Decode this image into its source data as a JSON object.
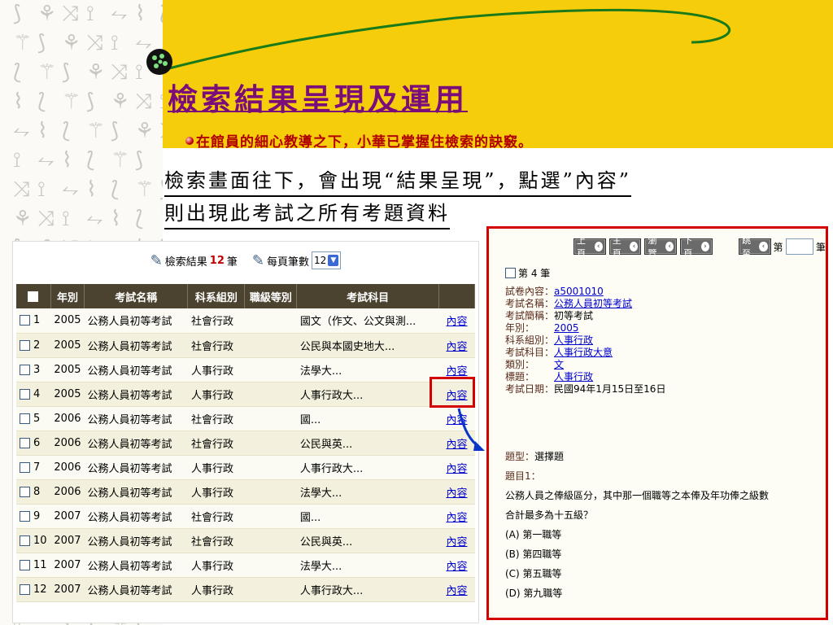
{
  "slide": {
    "title": "檢索結果呈現及運用",
    "subtitle": "在館員的細心教導之下，小華已掌握住檢索的訣竅。",
    "body_line1": "檢索畫面往下，會出現“結果呈現”，點選”內容”",
    "body_line2": "則出現此考試之所有考題資料"
  },
  "results": {
    "count_prefix": "檢索結果",
    "count": "12",
    "count_suffix": "筆",
    "per_page_label": "每頁筆數",
    "per_page_value": "12",
    "columns": [
      "年別",
      "考試名稱",
      "科系組別",
      "職級等別",
      "考試科目"
    ],
    "rows": [
      {
        "no": "1",
        "year": "2005",
        "exam": "公務人員初等考試",
        "dept": "社會行政",
        "grade": "",
        "subject": "國文（作文、公文與測...",
        "link": "內容"
      },
      {
        "no": "2",
        "year": "2005",
        "exam": "公務人員初等考試",
        "dept": "社會行政",
        "grade": "",
        "subject": "公民與本國史地大...",
        "link": "內容"
      },
      {
        "no": "3",
        "year": "2005",
        "exam": "公務人員初等考試",
        "dept": "人事行政",
        "grade": "",
        "subject": "法學大...",
        "link": "內容"
      },
      {
        "no": "4",
        "year": "2005",
        "exam": "公務人員初等考試",
        "dept": "人事行政",
        "grade": "",
        "subject": "人事行政大...",
        "link": "內容"
      },
      {
        "no": "5",
        "year": "2006",
        "exam": "公務人員初等考試",
        "dept": "社會行政",
        "grade": "",
        "subject": "國...",
        "link": "內容"
      },
      {
        "no": "6",
        "year": "2006",
        "exam": "公務人員初等考試",
        "dept": "社會行政",
        "grade": "",
        "subject": "公民與英...",
        "link": "內容"
      },
      {
        "no": "7",
        "year": "2006",
        "exam": "公務人員初等考試",
        "dept": "人事行政",
        "grade": "",
        "subject": "人事行政大...",
        "link": "內容"
      },
      {
        "no": "8",
        "year": "2006",
        "exam": "公務人員初等考試",
        "dept": "人事行政",
        "grade": "",
        "subject": "法學大...",
        "link": "內容"
      },
      {
        "no": "9",
        "year": "2007",
        "exam": "公務人員初等考試",
        "dept": "社會行政",
        "grade": "",
        "subject": "國...",
        "link": "內容"
      },
      {
        "no": "10",
        "year": "2007",
        "exam": "公務人員初等考試",
        "dept": "社會行政",
        "grade": "",
        "subject": "公民與英...",
        "link": "內容"
      },
      {
        "no": "11",
        "year": "2007",
        "exam": "公務人員初等考試",
        "dept": "人事行政",
        "grade": "",
        "subject": "法學大...",
        "link": "內容"
      },
      {
        "no": "12",
        "year": "2007",
        "exam": "公務人員初等考試",
        "dept": "人事行政",
        "grade": "",
        "subject": "人事行政大...",
        "link": "內容"
      }
    ]
  },
  "detail": {
    "nav": {
      "prev": "上頁",
      "home": "主頁",
      "browse": "瀏覽",
      "next": "下頁",
      "jump": "跳至",
      "page_prefix": "第",
      "page_suffix": "筆"
    },
    "record_label": "第 4 筆",
    "fields": [
      {
        "key": "試卷內容：",
        "value": "a5001010",
        "link": true
      },
      {
        "key": "考試名稱：",
        "value": "公務人員初等考試",
        "link": true
      },
      {
        "key": "考試簡稱：",
        "value": "初等考試",
        "link": false
      },
      {
        "key": "年別：",
        "value": "2005",
        "link": true
      },
      {
        "key": "科系組別：",
        "value": "人事行政",
        "link": true
      },
      {
        "key": "考試科目：",
        "value": "人事行政大意",
        "link": true
      },
      {
        "key": "類別：",
        "value": "文",
        "link": true
      },
      {
        "key": "標題：",
        "value": "人事行政",
        "link": true
      },
      {
        "key": "考試日期：",
        "value": "民國94年1月15日至16日",
        "link": false
      }
    ],
    "question_type_label": "題型：",
    "question_type": "選擇題",
    "question_no": "題目1：",
    "question_line1": "公務人員之俸級區分，其中那一個職等之本俸及年功俸之級數",
    "question_line2": "合計最多為十五級？",
    "options": [
      "(A) 第一職等",
      "(B) 第四職等",
      "(C) 第五職等",
      "(D) 第九職等"
    ]
  },
  "colors": {
    "header": "#f6cd0a",
    "title": "#7b0d7b",
    "subtitle": "#b00000",
    "highlight": "#d40000",
    "table_header": "#4b4330"
  }
}
